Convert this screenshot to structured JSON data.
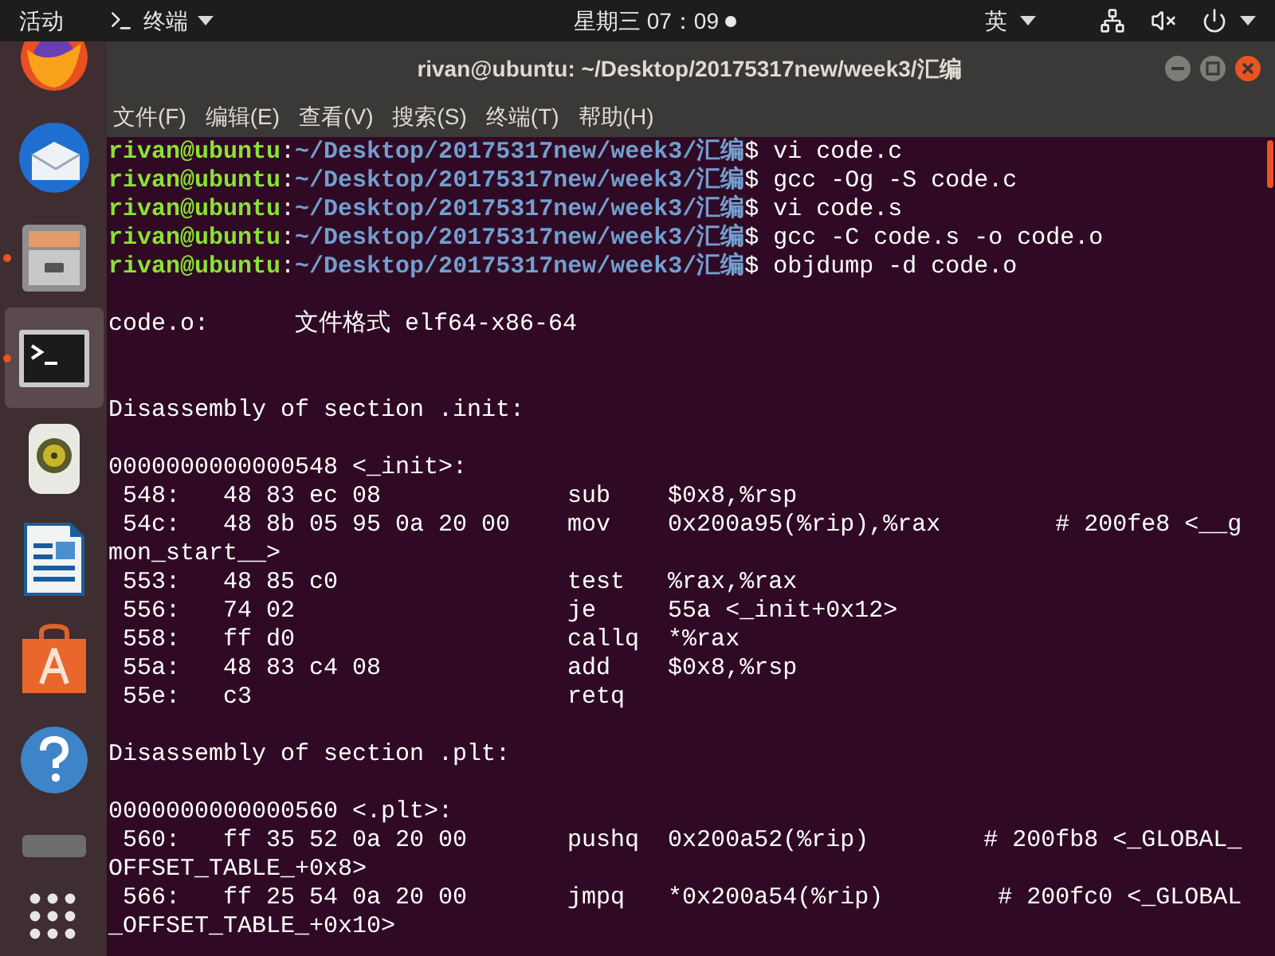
{
  "top_bar": {
    "activities": "活动",
    "app_menu": "终端",
    "clock": "星期三 07：09",
    "clock_notification": true,
    "input_method": "英"
  },
  "dock": {
    "items": [
      {
        "kind": "browser",
        "selected": false,
        "running": false
      },
      {
        "kind": "mail",
        "selected": false,
        "running": false
      },
      {
        "kind": "files",
        "selected": false,
        "running": true
      },
      {
        "kind": "terminal",
        "selected": true,
        "running": true
      },
      {
        "kind": "speaker",
        "selected": false,
        "running": false
      },
      {
        "kind": "document",
        "selected": false,
        "running": false
      },
      {
        "kind": "bag",
        "selected": false,
        "running": false
      },
      {
        "kind": "help",
        "selected": false,
        "running": false
      },
      {
        "kind": "partial",
        "selected": false,
        "running": false
      }
    ]
  },
  "window": {
    "title": "rivan@ubuntu: ~/Desktop/20175317new/week3/汇编",
    "menu": [
      "文件(F)",
      "编辑(E)",
      "查看(V)",
      "搜索(S)",
      "终端(T)",
      "帮助(H)"
    ],
    "terminal_lines": [
      {
        "kind": "prompt",
        "user": "rivan@ubuntu",
        "separator": ":",
        "path": "~/Desktop/20175317new/week3/汇编",
        "symbol": "$",
        "command": "vi code.c"
      },
      {
        "kind": "prompt",
        "user": "rivan@ubuntu",
        "separator": ":",
        "path": "~/Desktop/20175317new/week3/汇编",
        "symbol": "$",
        "command": "gcc -Og -S code.c"
      },
      {
        "kind": "prompt",
        "user": "rivan@ubuntu",
        "separator": ":",
        "path": "~/Desktop/20175317new/week3/汇编",
        "symbol": "$",
        "command": "vi code.s"
      },
      {
        "kind": "prompt",
        "user": "rivan@ubuntu",
        "separator": ":",
        "path": "~/Desktop/20175317new/week3/汇编",
        "symbol": "$",
        "command": "gcc -C code.s -o code.o"
      },
      {
        "kind": "prompt",
        "user": "rivan@ubuntu",
        "separator": ":",
        "path": "~/Desktop/20175317new/week3/汇编",
        "symbol": "$",
        "command": "objdump -d code.o"
      },
      {
        "kind": "blank"
      },
      {
        "kind": "output",
        "text": "code.o:      文件格式 elf64-x86-64"
      },
      {
        "kind": "blank"
      },
      {
        "kind": "blank"
      },
      {
        "kind": "output",
        "text": "Disassembly of section .init:"
      },
      {
        "kind": "blank"
      },
      {
        "kind": "output",
        "text": "0000000000000548 <_init>:"
      },
      {
        "kind": "output",
        "text": " 548:   48 83 ec 08             sub    $0x8,%rsp"
      },
      {
        "kind": "output",
        "text": " 54c:   48 8b 05 95 0a 20 00    mov    0x200a95(%rip),%rax        # 200fe8 <__g"
      },
      {
        "kind": "output",
        "text": "mon_start__>"
      },
      {
        "kind": "output",
        "text": " 553:   48 85 c0                test   %rax,%rax"
      },
      {
        "kind": "output",
        "text": " 556:   74 02                   je     55a <_init+0x12>"
      },
      {
        "kind": "output",
        "text": " 558:   ff d0                   callq  *%rax"
      },
      {
        "kind": "output",
        "text": " 55a:   48 83 c4 08             add    $0x8,%rsp"
      },
      {
        "kind": "output",
        "text": " 55e:   c3                      retq"
      },
      {
        "kind": "blank"
      },
      {
        "kind": "output",
        "text": "Disassembly of section .plt:"
      },
      {
        "kind": "blank"
      },
      {
        "kind": "output",
        "text": "0000000000000560 <.plt>:"
      },
      {
        "kind": "output",
        "text": " 560:   ff 35 52 0a 20 00       pushq  0x200a52(%rip)        # 200fb8 <_GLOBAL_"
      },
      {
        "kind": "output",
        "text": "OFFSET_TABLE_+0x8>"
      },
      {
        "kind": "output",
        "text": " 566:   ff 25 54 0a 20 00       jmpq   *0x200a54(%rip)        # 200fc0 <_GLOBAL"
      },
      {
        "kind": "output",
        "text": "_OFFSET_TABLE_+0x10>"
      }
    ]
  }
}
